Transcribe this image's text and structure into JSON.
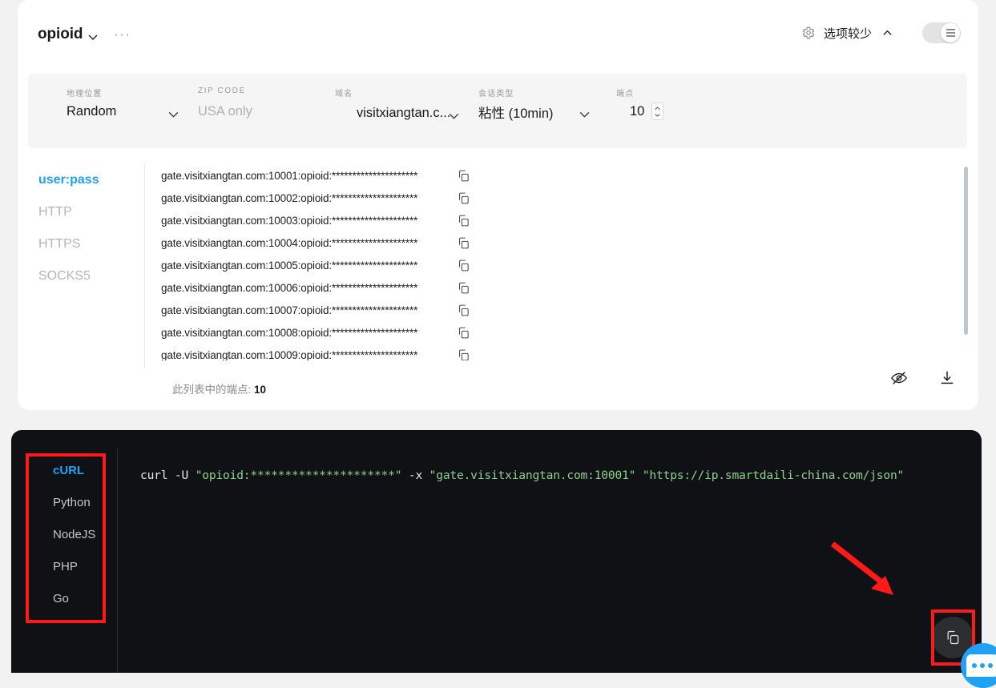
{
  "header": {
    "project_name": "opioid",
    "caret_icon": "chevron-down-icon",
    "more_icon": "···",
    "gear_icon": "gear-icon",
    "options_label": "选项较少",
    "options_caret_icon": "chevron-up-icon",
    "toggle_icon": "menu-icon"
  },
  "filters": [
    {
      "label": "地理位置",
      "value": "Random",
      "is_placeholder": false,
      "has_caret": true
    },
    {
      "label": "ZIP CODE",
      "value": "USA only",
      "is_placeholder": true,
      "has_caret": false
    },
    {
      "label": "域名",
      "value": "visitxiangtan.c...",
      "is_placeholder": false,
      "has_caret": true
    },
    {
      "label": "会话类型",
      "value": "粘性 (10min)",
      "is_placeholder": false,
      "has_caret": true
    },
    {
      "label": "端点",
      "value": "10",
      "is_placeholder": false,
      "has_caret": false
    }
  ],
  "format_tabs": [
    {
      "label": "user:pass",
      "active": true
    },
    {
      "label": "HTTP",
      "active": false
    },
    {
      "label": "HTTPS",
      "active": false
    },
    {
      "label": "SOCKS5",
      "active": false
    }
  ],
  "proxy_list": {
    "rows": [
      "gate.visitxiangtan.com:10001:opioid:*********************",
      "gate.visitxiangtan.com:10002:opioid:*********************",
      "gate.visitxiangtan.com:10003:opioid:*********************",
      "gate.visitxiangtan.com:10004:opioid:*********************",
      "gate.visitxiangtan.com:10005:opioid:*********************",
      "gate.visitxiangtan.com:10006:opioid:*********************",
      "gate.visitxiangtan.com:10007:opioid:*********************",
      "gate.visitxiangtan.com:10008:opioid:*********************",
      "gate.visitxiangtan.com:10009:opioid:*********************"
    ],
    "copy_icon": "copy-icon",
    "count_label": "此列表中的端点:",
    "count_value": "10",
    "hide_icon": "eye-off-icon",
    "download_icon": "download-icon"
  },
  "code_panel": {
    "tabs": [
      {
        "label": "cURL",
        "active": true
      },
      {
        "label": "Python",
        "active": false
      },
      {
        "label": "NodeJS",
        "active": false
      },
      {
        "label": "PHP",
        "active": false
      },
      {
        "label": "Go",
        "active": false
      }
    ],
    "command_prefix": "curl -U ",
    "credential": "\"opioid:*********************\"",
    "proxy_flag": " -x ",
    "proxy_target": "\"gate.visitxiangtan.com:10001\"",
    "space": " ",
    "url": "\"https://ip.smartdaili-china.com/json\"",
    "copy_icon": "copy-icon"
  },
  "chat_widget": {
    "icon": "chat-bubble-icon"
  },
  "colors": {
    "accent_blue": "#1ea1f7",
    "annotation_red": "#ff1a1a",
    "panel_dark": "#101114",
    "code_string_green": "#8fd08f",
    "page_bg": "#f2f2f2"
  }
}
